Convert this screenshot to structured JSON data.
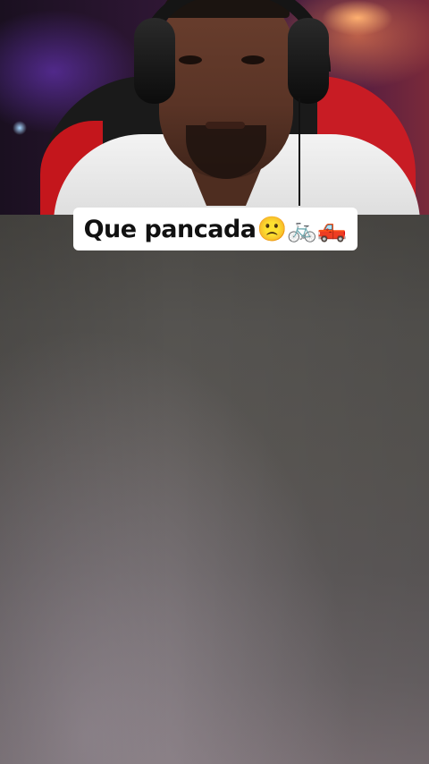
{
  "caption": {
    "text": "Que pancada",
    "emojis": "🙁🚲🛻"
  },
  "colors": {
    "caption_bg": "#ffffff",
    "caption_text": "#111111",
    "chair_red": "#c4161c",
    "video_bg": "#555350"
  }
}
